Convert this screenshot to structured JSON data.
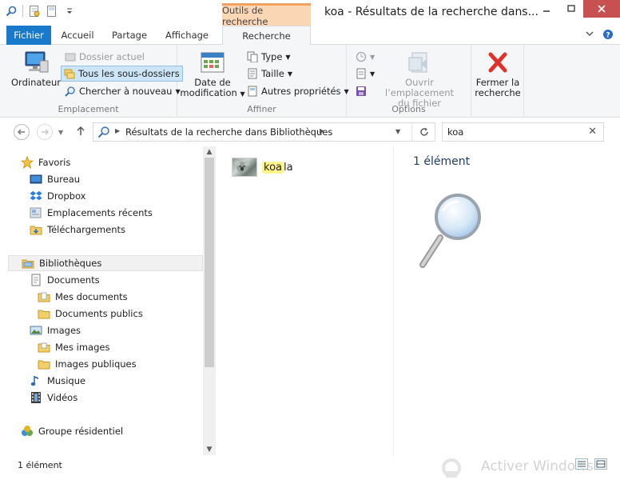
{
  "title_bar": {
    "contextual_tab_group": "Outils de recherche",
    "window_title": "koa - Résultats de la recherche dans..."
  },
  "ribbon_tabs": {
    "file": "Fichier",
    "home": "Accueil",
    "share": "Partage",
    "view": "Affichage",
    "search": "Recherche"
  },
  "ribbon": {
    "location": {
      "computer": "Ordinateur",
      "current_folder": "Dossier actuel",
      "all_subfolders": "Tous les sous-dossiers",
      "search_again": "Chercher à nouveau",
      "label": "Emplacement"
    },
    "refine": {
      "date_modified_line1": "Date de",
      "date_modified_line2": "modification",
      "type": "Type",
      "size": "Taille",
      "other_properties": "Autres propriétés",
      "label": "Affiner"
    },
    "options": {
      "open_location_line1": "Ouvrir l’emplacement",
      "open_location_line2": "du fichier",
      "label": "Options"
    },
    "close": {
      "close_line1": "Fermer la",
      "close_line2": "recherche"
    }
  },
  "address_bar": {
    "breadcrumb": "Résultats de la recherche dans Bibliothèques"
  },
  "search": {
    "value": "koa"
  },
  "nav_pane": {
    "favorites": "Favoris",
    "desktop": "Bureau",
    "dropbox": "Dropbox",
    "recent": "Emplacements récents",
    "downloads": "Téléchargements",
    "libraries": "Bibliothèques",
    "documents": "Documents",
    "my_documents": "Mes documents",
    "public_documents": "Documents publics",
    "images": "Images",
    "my_images": "Mes images",
    "public_images": "Images publiques",
    "music": "Musique",
    "videos": "Vidéos",
    "homegroup": "Groupe résidentiel"
  },
  "results": [
    {
      "match": "koa",
      "rest": "la"
    }
  ],
  "preview": {
    "count": "1 élément"
  },
  "status_bar": {
    "count": "1 élément",
    "watermark": "Activer Windows"
  }
}
